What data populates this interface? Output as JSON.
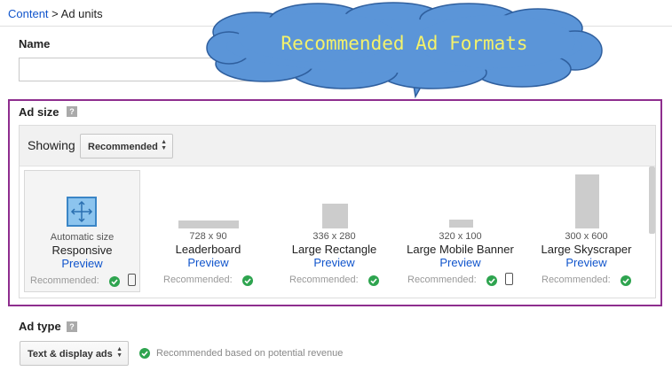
{
  "breadcrumb": {
    "parent": "Content",
    "separator": " > ",
    "current": "Ad units"
  },
  "name_field": {
    "label": "Name",
    "value": ""
  },
  "ad_size": {
    "label": "Ad size",
    "help": "?",
    "showing_label": "Showing",
    "showing_value": "Recommended",
    "formats": [
      {
        "dims": "Automatic size",
        "name": "Responsive",
        "preview": "Preview",
        "recommended": "Recommended:",
        "mobile": true,
        "selected": true
      },
      {
        "dims": "728 x 90",
        "name": "Leaderboard",
        "preview": "Preview",
        "recommended": "Recommended:",
        "mobile": false
      },
      {
        "dims": "336 x 280",
        "name": "Large Rectangle",
        "preview": "Preview",
        "recommended": "Recommended:",
        "mobile": false
      },
      {
        "dims": "320 x 100",
        "name": "Large Mobile Banner",
        "preview": "Preview",
        "recommended": "Recommended:",
        "mobile": true
      },
      {
        "dims": "300 x 600",
        "name": "Large Skyscraper",
        "preview": "Preview",
        "recommended": "Recommended:",
        "mobile": false
      }
    ]
  },
  "ad_type": {
    "label": "Ad type",
    "help": "?",
    "value": "Text & display ads",
    "note": "Recommended based on potential revenue"
  },
  "callout": {
    "text": "Recommended Ad Formats"
  },
  "colors": {
    "highlight": "#8e2e8e",
    "link": "#1155cc",
    "check": "#2ea44f",
    "callout_fill": "#5b95d8",
    "callout_text": "#f4f26a"
  }
}
